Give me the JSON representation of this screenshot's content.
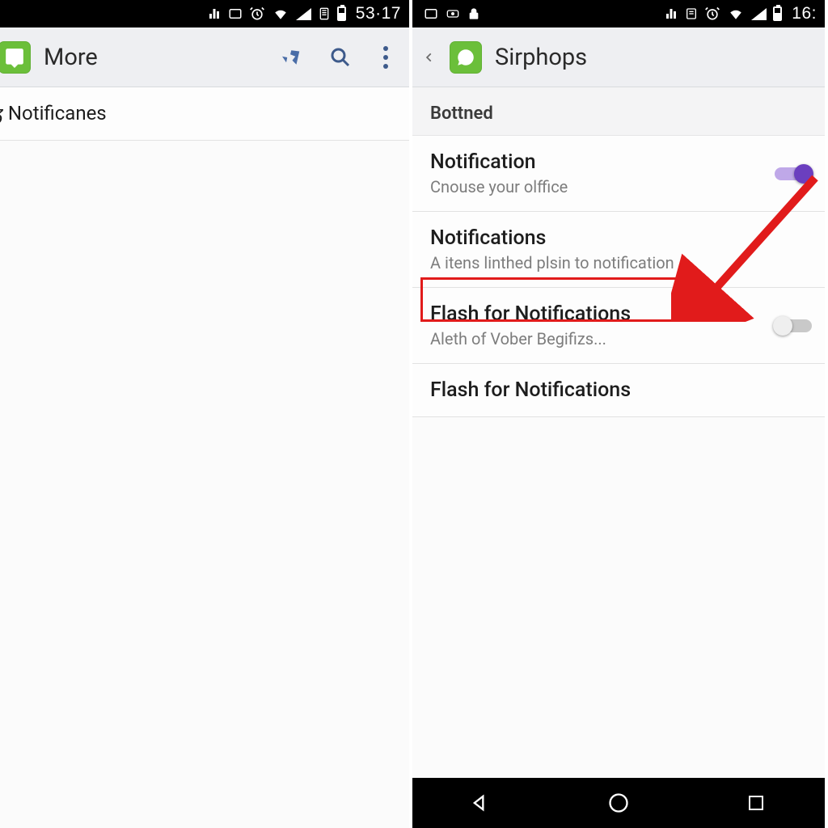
{
  "left": {
    "status": {
      "time": "53·17"
    },
    "appbar": {
      "title": "More"
    },
    "rows": [
      {
        "title": "Notificanes"
      }
    ]
  },
  "right": {
    "status": {
      "time": "16:"
    },
    "appbar": {
      "title": "Sirphops"
    },
    "section_header": "Bottned",
    "rows": [
      {
        "title": "Notification",
        "sub": "Cnouse your olffice",
        "toggle": "on"
      },
      {
        "title": "Notifications",
        "sub": "A itens linthed plsin to notification"
      },
      {
        "title": "Flash for Notifications",
        "sub": "Aleth of Vober Begifizs...",
        "toggle": "off",
        "highlighted": true
      },
      {
        "title": "Flash for Notifications"
      }
    ]
  }
}
